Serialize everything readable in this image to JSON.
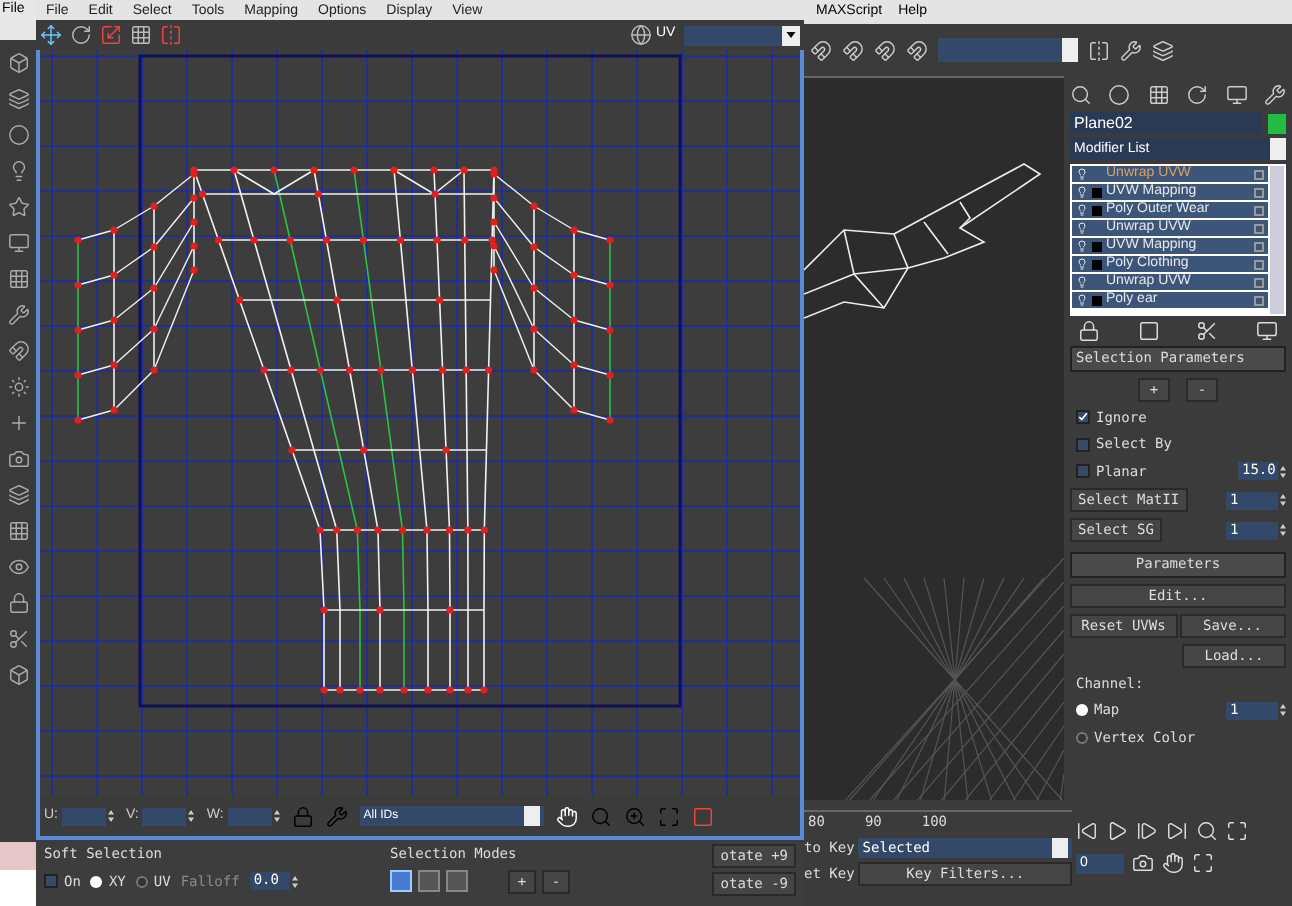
{
  "left_strip": {
    "menu": "File"
  },
  "uvw_editor": {
    "menu": [
      "File",
      "Edit",
      "Select",
      "Tools",
      "Mapping",
      "Options",
      "Display",
      "View"
    ],
    "toolbar": {
      "mode_label": "UV"
    },
    "bottom_bar": {
      "fields": [
        {
          "label": "U:"
        },
        {
          "label": "V:"
        },
        {
          "label": "W:"
        }
      ],
      "id_filter": "All IDs"
    }
  },
  "soft_selection": {
    "title": "Soft Selection",
    "on": {
      "label": "On",
      "checked": false
    },
    "radios": [
      {
        "label": "XY",
        "selected": true
      },
      {
        "label": "UV",
        "selected": false
      }
    ],
    "falloff": {
      "label": "Falloff",
      "disabled": true,
      "value": "0.0"
    }
  },
  "selection_modes": {
    "title": "Selection Modes",
    "modes": [
      {
        "selected": true
      },
      {
        "selected": false
      },
      {
        "selected": false
      }
    ],
    "buttons": [
      "+",
      "-"
    ]
  },
  "rotate_buttons": [
    "otate +9",
    "otate -9"
  ],
  "main_menu": [
    "MAXScript",
    "Help"
  ],
  "command_panel": {
    "object_name": "Plane02",
    "modifier_list": "Modifier List",
    "stack": [
      {
        "label": "Unwrap UVW",
        "selected": true,
        "expandable": false
      },
      {
        "label": "UVW Mapping",
        "selected": false,
        "expandable": true
      },
      {
        "label": "Poly Outer Wear",
        "selected": false,
        "expandable": true
      },
      {
        "label": "Unwrap UVW",
        "selected": false,
        "expandable": false
      },
      {
        "label": "UVW Mapping",
        "selected": false,
        "expandable": true
      },
      {
        "label": "Poly Clothing",
        "selected": false,
        "expandable": true
      },
      {
        "label": "Unwrap UVW",
        "selected": false,
        "expandable": false
      },
      {
        "label": "Poly ear",
        "selected": false,
        "expandable": true
      }
    ],
    "selection_parameters": {
      "title": "Selection Parameters",
      "buttons": [
        "+",
        "-"
      ],
      "options": [
        {
          "label": "Ignore",
          "checked": true
        },
        {
          "label": "Select By",
          "checked": false
        },
        {
          "label": "Planar",
          "checked": false
        }
      ],
      "planar_value": "15.0",
      "select_matid": {
        "label": "Select MatII",
        "value": "1"
      },
      "select_sg": {
        "label": "Select SG",
        "value": "1"
      }
    },
    "parameters": {
      "title": "Parameters",
      "edit": "Edit...",
      "reset": "Reset UVWs",
      "save": "Save...",
      "load": "Load...",
      "channel": {
        "label": "Channel:",
        "options": [
          {
            "label": "Map",
            "selected": true
          },
          {
            "label": "Vertex Color",
            "selected": false
          }
        ],
        "value": "1"
      }
    }
  },
  "timeline": {
    "ticks": [
      "80",
      "90",
      "100"
    ],
    "to_key": "to Key",
    "key_mode": "Selected",
    "set_key": "et Key",
    "key_filters": "Key Filters...",
    "frame": "0"
  }
}
